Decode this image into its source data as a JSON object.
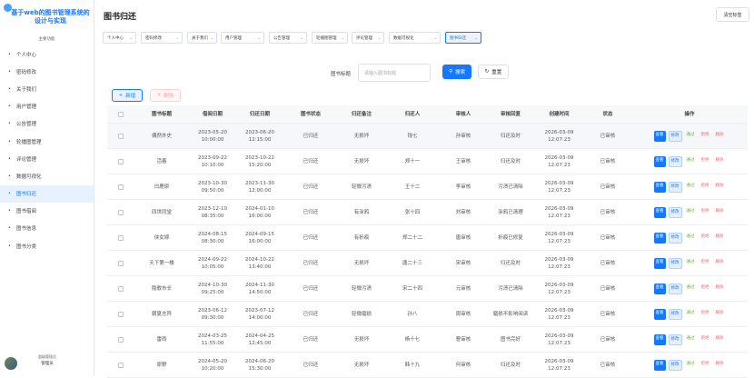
{
  "app": {
    "title": "基于web的图书管理系统的设计与实现"
  },
  "sidebar": {
    "section_title": "主要功能",
    "items": [
      {
        "label": "个人中心",
        "active": false
      },
      {
        "label": "密码修改",
        "active": false
      },
      {
        "label": "关于我们",
        "active": false
      },
      {
        "label": "用户管理",
        "active": false
      },
      {
        "label": "公告管理",
        "active": false
      },
      {
        "label": "轮播图管理",
        "active": false
      },
      {
        "label": "评论管理",
        "active": false
      },
      {
        "label": "数据可视化",
        "active": false
      },
      {
        "label": "图书归还",
        "active": true
      },
      {
        "label": "图书借阅",
        "active": false
      },
      {
        "label": "图书信息",
        "active": false
      },
      {
        "label": "图书分类",
        "active": false
      }
    ],
    "footer_line1": "超级管理员",
    "footer_line2": "管理员"
  },
  "header": {
    "page_title": "图书归还",
    "clear_tabs_label": "清空标签"
  },
  "tabs": [
    {
      "label": "个人中心",
      "active": false
    },
    {
      "label": "密码修改",
      "active": false
    },
    {
      "label": "关于我们",
      "active": false
    },
    {
      "label": "用户管理",
      "active": false
    },
    {
      "label": "公告管理",
      "active": false
    },
    {
      "label": "轮播图管理",
      "active": false
    },
    {
      "label": "评论管理",
      "active": false
    },
    {
      "label": "数据可视化",
      "active": false
    },
    {
      "label": "图书归还",
      "active": true
    }
  ],
  "search": {
    "label": "图书标题",
    "placeholder": "请输入图书标题",
    "search_button": "搜索",
    "reset_button": "重置"
  },
  "toolbar": {
    "add_label": "新增",
    "delete_label": "删除"
  },
  "table": {
    "columns": [
      "图书标题",
      "借阅日期",
      "归还日期",
      "图书状态",
      "归还备注",
      "归还人",
      "审核人",
      "审核回复",
      "创建时间",
      "状态",
      "操作"
    ],
    "ops": {
      "view": "查看",
      "edit": "修改",
      "pass": "通过",
      "reject": "拒绝",
      "delete": "删除"
    },
    "rows": [
      {
        "title": "偶然外史",
        "borrow": "2023-05-20 10:00:00",
        "return": "2023-06-20 12:15:00",
        "book_status": "已归还",
        "remark": "无损坏",
        "returner": "钱七",
        "reviewer": "孙审核",
        "reply": "归还及时",
        "created": "2026-03-09 12:07:23",
        "status": "已审核"
      },
      {
        "title": "活着",
        "borrow": "2023-09-22 10:10:00",
        "return": "2023-10-22 15:20:00",
        "book_status": "已归还",
        "remark": "无损坏",
        "returner": "郑十一",
        "reviewer": "王审核",
        "reply": "归还及时",
        "created": "2026-03-09 12:07:23",
        "status": "已审核"
      },
      {
        "title": "白鹿原",
        "borrow": "2023-10-30 09:50:00",
        "return": "2023-11-30 12:00:00",
        "book_status": "已归还",
        "remark": "轻微污渍",
        "returner": "王十二",
        "reviewer": "李审核",
        "reply": "污渍已清除",
        "created": "2026-03-09 12:07:23",
        "status": "已审核"
      },
      {
        "title": "四世同堂",
        "borrow": "2023-12-10 08:35:00",
        "return": "2024-01-10 16:00:00",
        "book_status": "已归还",
        "remark": "有涂鸦",
        "returner": "张十四",
        "reviewer": "刘审核",
        "reply": "涂鸦已清理",
        "created": "2026-03-09 12:07:23",
        "status": "已审核"
      },
      {
        "title": "侠女嫁",
        "borrow": "2024-08-15 08:30:00",
        "return": "2024-09-15 16:00:00",
        "book_status": "已归还",
        "remark": "有折痕",
        "returner": "郑二十二",
        "reviewer": "唐审核",
        "reply": "折痕已修复",
        "created": "2026-03-09 12:07:23",
        "status": "已审核"
      },
      {
        "title": "天下第一楼",
        "borrow": "2024-09-22 10:05:00",
        "return": "2024-10-22 13:40:00",
        "book_status": "已归还",
        "remark": "无损坏",
        "returner": "唐二十三",
        "reviewer": "宋审核",
        "reply": "归还及时",
        "created": "2026-03-09 12:07:23",
        "status": "已审核"
      },
      {
        "title": "隐歌市长",
        "borrow": "2024-10-30 09:25:00",
        "return": "2024-11-30 14:50:00",
        "book_status": "已归还",
        "remark": "轻微污渍",
        "returner": "宋二十四",
        "reviewer": "元审核",
        "reply": "污渍已清除",
        "created": "2026-03-09 12:07:23",
        "status": "已审核"
      },
      {
        "title": "朝夏志异",
        "borrow": "2023-06-12 09:30:00",
        "return": "2023-07-12 14:00:00",
        "book_status": "已归还",
        "remark": "轻微磨损",
        "returner": "孙八",
        "reviewer": "周审核",
        "reply": "磨损不影响阅读",
        "created": "2026-03-09 12:07:23",
        "status": "已审核"
      },
      {
        "title": "雷雨",
        "borrow": "2024-03-25 11:55:00",
        "return": "2024-04-25 12:45:00",
        "book_status": "已归还",
        "remark": "无损坏",
        "returner": "杨十七",
        "reviewer": "曹审核",
        "reply": "图书完好",
        "created": "2026-03-09 12:07:23",
        "status": "已审核"
      },
      {
        "title": "原野",
        "borrow": "2024-05-20 10:20:00",
        "return": "2024-06-20 15:30:00",
        "book_status": "已归还",
        "remark": "无损坏",
        "returner": "韩十九",
        "reviewer": "何审核",
        "reply": "归还及时",
        "created": "2026-03-09 12:07:23",
        "status": "已审核"
      }
    ]
  }
}
